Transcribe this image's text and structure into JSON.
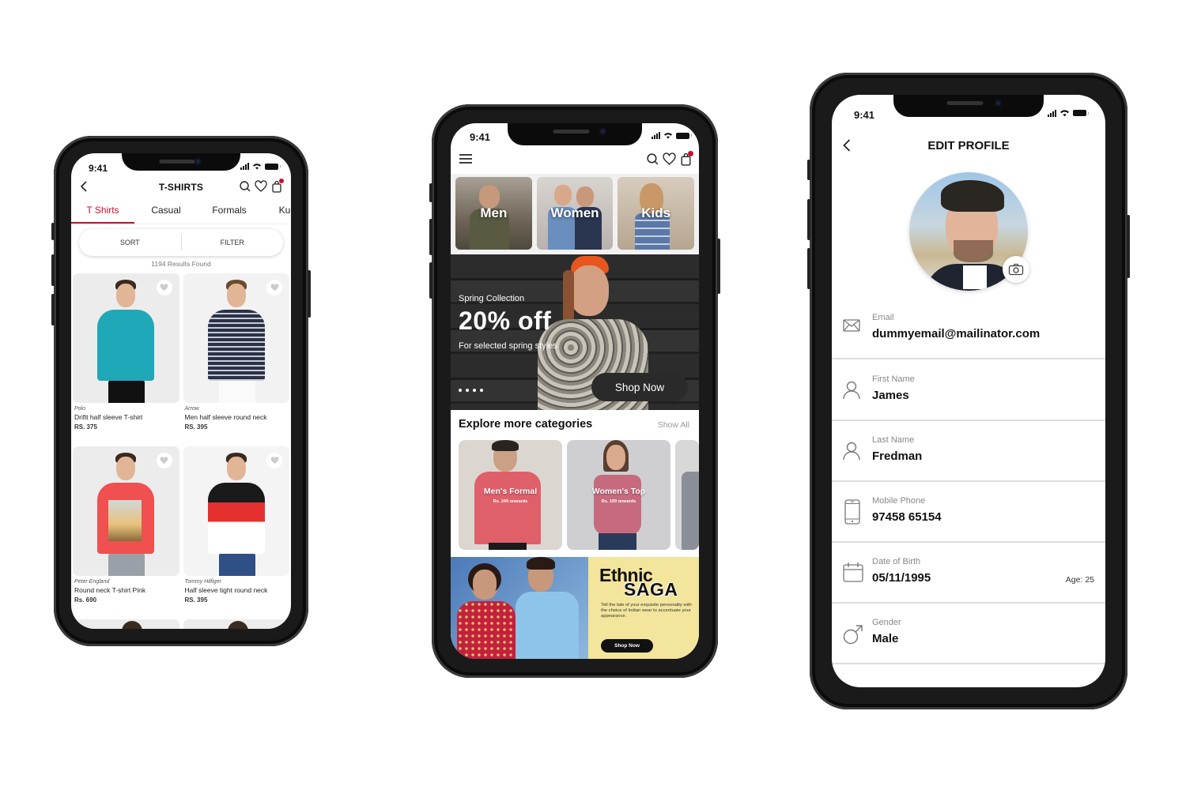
{
  "status_bar": {
    "time": "9:41"
  },
  "listing_screen": {
    "title": "T-SHIRTS",
    "tabs": [
      {
        "label": "T Shirts",
        "active": true
      },
      {
        "label": "Casual",
        "active": false
      },
      {
        "label": "Formals",
        "active": false
      },
      {
        "label": "Ku",
        "active": false
      }
    ],
    "sort_label": "SORT",
    "filter_label": "FILTER",
    "results_text": "1194 Results Found",
    "accent_color": "#c8102e",
    "products": [
      {
        "brand": "Polo",
        "name": "Drifit half sleeve T-shirt",
        "price": "RS. 375",
        "shirt_color": "#1fa8b8"
      },
      {
        "brand": "Arrow",
        "name": "Men half sleeve round neck",
        "price": "RS. 395",
        "shirt_color": "#2b3247"
      },
      {
        "brand": "Peter England",
        "name": "Round neck T-shirt Pink",
        "price": "Rs. 690",
        "shirt_color": "#f0504f"
      },
      {
        "brand": "Tommy Hilfiger",
        "name": "Half sleeve tight round neck",
        "price": "RS. 395",
        "shirt_color": "#e53030"
      }
    ]
  },
  "home_screen": {
    "categories": [
      {
        "label": "Men"
      },
      {
        "label": "Women"
      },
      {
        "label": "Kids"
      }
    ],
    "banner": {
      "subtitle": "Spring Collection",
      "headline": "20% off",
      "description": "For selected spring styles",
      "cta": "Shop Now",
      "slide_count": 4
    },
    "explore": {
      "title": "Explore more categories",
      "show_all": "Show All",
      "items": [
        {
          "name": "Men's Formal",
          "price": "Rs. 249 onwards"
        },
        {
          "name": "Women's Top",
          "price": "Rs. 199 onwards"
        }
      ]
    },
    "ethnic_banner": {
      "title_line1": "Ethnic",
      "title_line2": "SAGA",
      "description": "Tell the tale of your exquisite personality with the choice of Indian wear to accentuate your appearance.",
      "cta": "Shop Now"
    }
  },
  "profile_screen": {
    "title": "EDIT PROFILE",
    "fields": [
      {
        "label": "Email",
        "value": "dummyemail@mailinator.com",
        "icon": "mail-icon"
      },
      {
        "label": "First Name",
        "value": "James",
        "icon": "user-icon"
      },
      {
        "label": "Last Name",
        "value": "Fredman",
        "icon": "user-icon"
      },
      {
        "label": "Mobile Phone",
        "value": "97458 65154",
        "icon": "phone-icon"
      },
      {
        "label": "Date of Birth",
        "value": "05/11/1995",
        "extra": "Age: 25",
        "icon": "calendar-icon"
      },
      {
        "label": "Gender",
        "value": "Male",
        "icon": "male-icon"
      }
    ]
  }
}
